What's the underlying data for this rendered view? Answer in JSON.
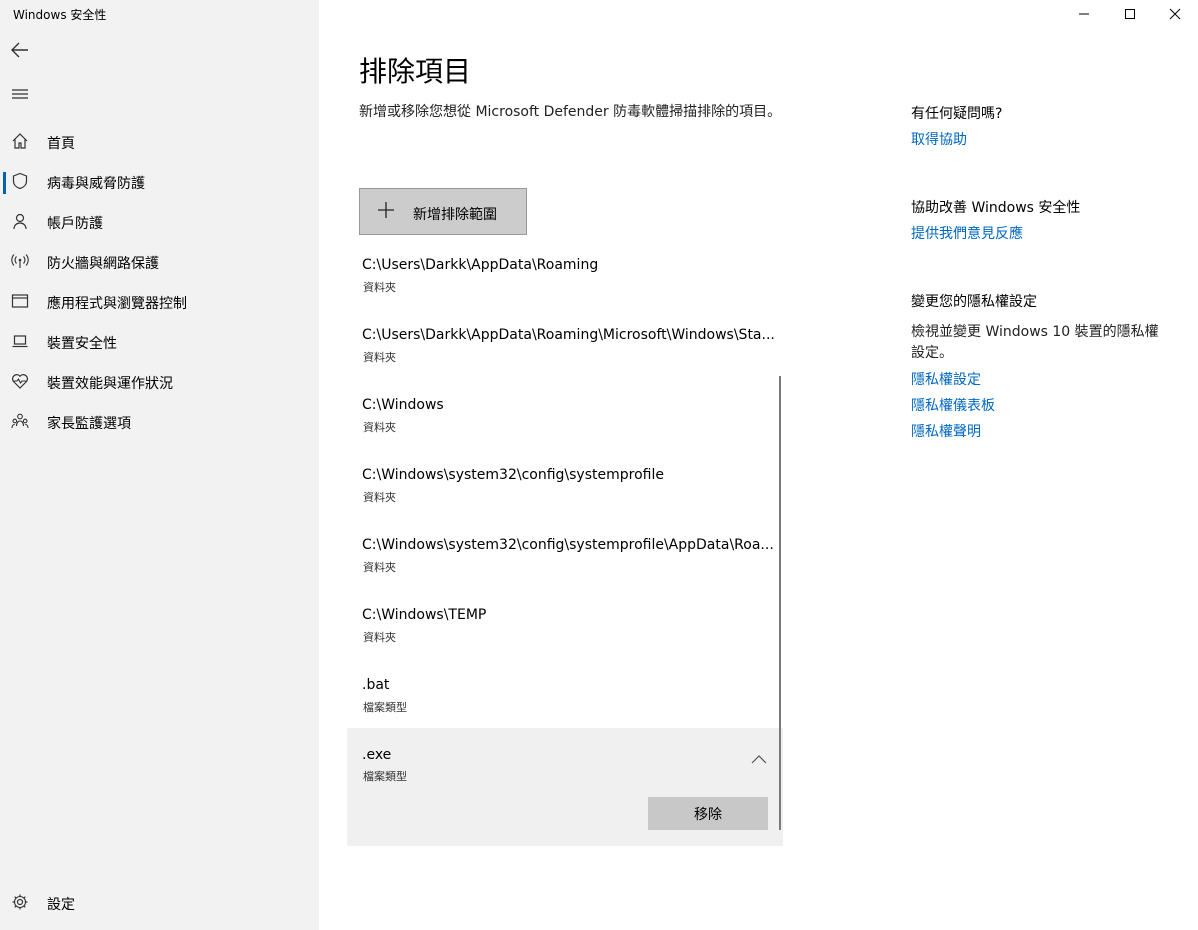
{
  "window": {
    "title": "Windows 安全性",
    "controls": [
      "minimize-icon",
      "maximize-icon",
      "close-icon"
    ]
  },
  "sidebar": {
    "items": [
      {
        "label": "首頁",
        "icon": "home-icon",
        "selected": false
      },
      {
        "label": "病毒與威脅防護",
        "icon": "shield-icon",
        "selected": true
      },
      {
        "label": "帳戶防護",
        "icon": "person-icon",
        "selected": false
      },
      {
        "label": "防火牆與網路保護",
        "icon": "wireless-icon",
        "selected": false
      },
      {
        "label": "應用程式與瀏覽器控制",
        "icon": "app-window-icon",
        "selected": false
      },
      {
        "label": "裝置安全性",
        "icon": "laptop-icon",
        "selected": false
      },
      {
        "label": "裝置效能與運作狀況",
        "icon": "heart-pulse-icon",
        "selected": false
      },
      {
        "label": "家長監護選項",
        "icon": "family-icon",
        "selected": false
      }
    ],
    "settings_label": "設定"
  },
  "main": {
    "title": "排除項目",
    "description": "新增或移除您想從 Microsoft Defender 防毒軟體掃描排除的項目。",
    "add_button_label": "新增排除範圍",
    "exclusions": [
      {
        "path": "C:\\Users\\Darkk\\AppData\\Roaming",
        "type": "資料夾"
      },
      {
        "path": "C:\\Users\\Darkk\\AppData\\Roaming\\Microsoft\\Windows\\Sta...",
        "type": "資料夾"
      },
      {
        "path": "C:\\Windows",
        "type": "資料夾"
      },
      {
        "path": "C:\\Windows\\system32\\config\\systemprofile",
        "type": "資料夾"
      },
      {
        "path": "C:\\Windows\\system32\\config\\systemprofile\\AppData\\Roa...",
        "type": "資料夾"
      },
      {
        "path": "C:\\Windows\\TEMP",
        "type": "資料夾"
      },
      {
        "path": ".bat",
        "type": "檔案類型"
      },
      {
        "path": ".exe",
        "type": "檔案類型"
      }
    ],
    "remove_button_label": "移除"
  },
  "aside": {
    "help_heading": "有任何疑問嗎?",
    "help_link": "取得協助",
    "improve_heading": "協助改善 Windows 安全性",
    "feedback_link": "提供我們意見反應",
    "privacy_heading": "變更您的隱私權設定",
    "privacy_text": "檢視並變更 Windows 10 裝置的隱私權設定。",
    "privacy_links": [
      "隱私權設定",
      "隱私權儀表板",
      "隱私權聲明"
    ]
  },
  "colors": {
    "accent": "#0067c0",
    "sidebar_bg": "#f2f2f2",
    "selected_bar": "#0063b1"
  }
}
